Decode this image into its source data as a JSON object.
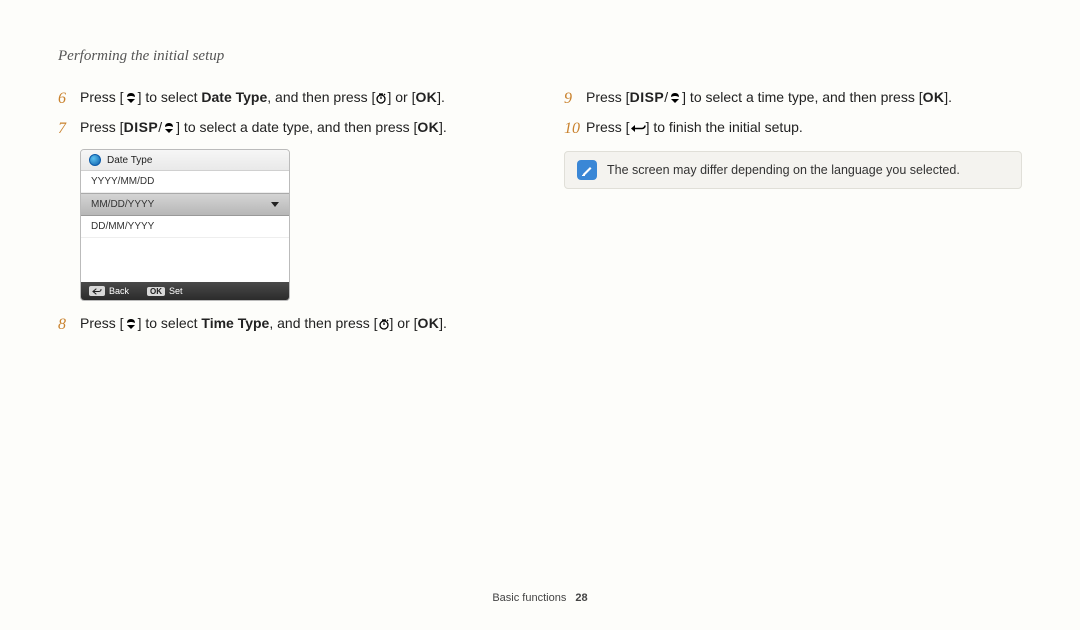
{
  "header": {
    "title": "Performing the initial setup"
  },
  "left": {
    "step6": {
      "num": "6",
      "t1": "Press [",
      "t2": "] to select ",
      "bold": "Date Type",
      "t3": ", and then press [",
      "t4": "] or [",
      "t5": "]."
    },
    "step7": {
      "num": "7",
      "t1": "Press [",
      "t2": "/",
      "t3": "] to select a date type, and then press [",
      "t4": "]."
    },
    "device": {
      "title": "Date Type",
      "rows": [
        "YYYY/MM/DD",
        "MM/DD/YYYY",
        "DD/MM/YYYY"
      ],
      "selected_index": 1,
      "footer_back": "Back",
      "footer_ok_label": "OK",
      "footer_set": "Set"
    },
    "step8": {
      "num": "8",
      "t1": "Press [",
      "t2": "] to select ",
      "bold": "Time Type",
      "t3": ", and then press [",
      "t4": "] or [",
      "t5": "]."
    }
  },
  "right": {
    "step9": {
      "num": "9",
      "t1": "Press [",
      "t2": "/",
      "t3": "] to select a time type, and then press [",
      "t4": "]."
    },
    "step10": {
      "num": "10",
      "t1": "Press [",
      "t2": "] to finish the initial setup."
    },
    "note": {
      "text": "The screen may differ depending on the language you selected."
    }
  },
  "labels": {
    "disp": "DISP",
    "ok": "OK"
  },
  "footer": {
    "section": "Basic functions",
    "page": "28"
  }
}
